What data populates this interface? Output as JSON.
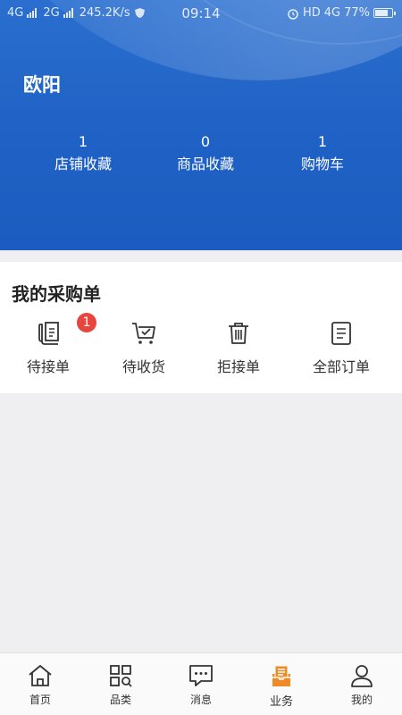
{
  "status_bar": {
    "network1": "4G",
    "network2": "2G",
    "speed": "245.2K/s",
    "time": "09:14",
    "hd": "HD",
    "network3": "4G",
    "battery": "77%"
  },
  "profile": {
    "name": "欧阳"
  },
  "stats": [
    {
      "value": "1",
      "label": "店铺收藏"
    },
    {
      "value": "0",
      "label": "商品收藏"
    },
    {
      "value": "1",
      "label": "购物车"
    }
  ],
  "orders": {
    "title": "我的采购单",
    "items": [
      {
        "label": "待接单",
        "icon": "pending-order-icon",
        "badge": "1"
      },
      {
        "label": "待收货",
        "icon": "cart-check-icon"
      },
      {
        "label": "拒接单",
        "icon": "trash-icon"
      },
      {
        "label": "全部订单",
        "icon": "order-list-icon"
      }
    ]
  },
  "tabbar": {
    "items": [
      {
        "label": "首页",
        "icon": "home-icon"
      },
      {
        "label": "品类",
        "icon": "category-icon"
      },
      {
        "label": "消息",
        "icon": "message-icon"
      },
      {
        "label": "业务",
        "icon": "business-icon",
        "active": true
      },
      {
        "label": "我的",
        "icon": "profile-icon"
      }
    ],
    "active_color": "#f08a24"
  }
}
